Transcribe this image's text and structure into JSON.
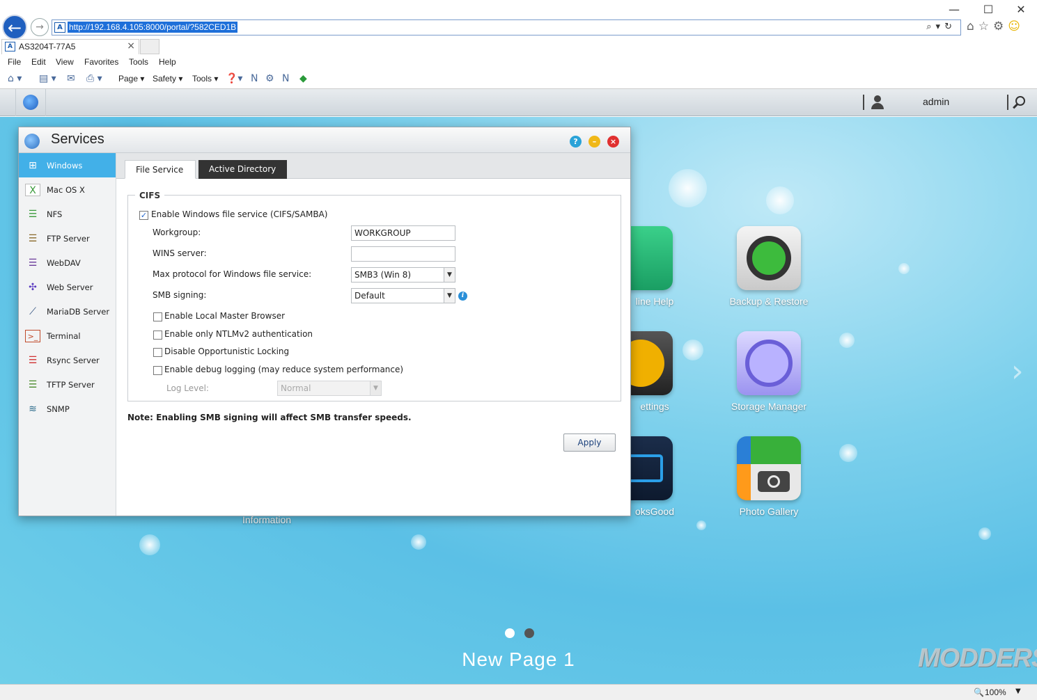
{
  "browser": {
    "url": "http://192.168.4.105:8000/portal/?582CED1B",
    "tab_title": "AS3204T-77A5",
    "menus": [
      "File",
      "Edit",
      "View",
      "Favorites",
      "Tools",
      "Help"
    ],
    "commands": [
      "Page",
      "Safety",
      "Tools"
    ],
    "zoom": "100%"
  },
  "adm": {
    "username": "admin"
  },
  "desktop": {
    "apps": [
      {
        "label": "Online Help",
        "icon": "online-help-icon"
      },
      {
        "label": "Backup & Restore",
        "icon": "backup-restore-icon"
      },
      {
        "label": "Settings",
        "icon": "settings-icon"
      },
      {
        "label": "Storage Manager",
        "icon": "storage-manager-icon"
      },
      {
        "label": "LooksGood",
        "icon": "looksgood-icon"
      },
      {
        "label": "Photo Gallery",
        "icon": "photo-gallery-icon"
      }
    ],
    "partial_labels": {
      "help": "line Help",
      "settings": "ettings",
      "looksgood": "oksGood",
      "information": "Information"
    },
    "page_name": "New Page 1",
    "watermark": "MODDERS"
  },
  "window": {
    "title": "Services",
    "nav": [
      {
        "label": "Windows",
        "icon": "windows-icon",
        "active": true
      },
      {
        "label": "Mac OS X",
        "icon": "mac-os-icon"
      },
      {
        "label": "NFS",
        "icon": "nfs-icon"
      },
      {
        "label": "FTP Server",
        "icon": "ftp-server-icon"
      },
      {
        "label": "WebDAV",
        "icon": "webdav-icon"
      },
      {
        "label": "Web Server",
        "icon": "web-server-icon"
      },
      {
        "label": "MariaDB Server",
        "icon": "mariadb-icon"
      },
      {
        "label": "Terminal",
        "icon": "terminal-icon"
      },
      {
        "label": "Rsync Server",
        "icon": "rsync-icon"
      },
      {
        "label": "TFTP Server",
        "icon": "tftp-icon"
      },
      {
        "label": "SNMP",
        "icon": "snmp-icon"
      }
    ],
    "tabs": [
      "File Service",
      "Active Directory"
    ],
    "cifs": {
      "legend": "CIFS",
      "enable_label": "Enable Windows file service (CIFS/SAMBA)",
      "workgroup_label": "Workgroup:",
      "workgroup_value": "WORKGROUP",
      "wins_label": "WINS server:",
      "wins_value": "",
      "max_protocol_label": "Max protocol for Windows file service:",
      "max_protocol_value": "SMB3 (Win 8)",
      "smb_signing_label": "SMB signing:",
      "smb_signing_value": "Default",
      "local_master_label": "Enable Local Master Browser",
      "ntlmv2_label": "Enable only NTLMv2 authentication",
      "oplock_label": "Disable Opportunistic Locking",
      "debug_label": "Enable debug logging (may reduce system performance)",
      "log_level_label": "Log Level:",
      "log_level_value": "Normal"
    },
    "note": "Note: Enabling SMB signing will affect SMB transfer speeds.",
    "apply_label": "Apply"
  }
}
